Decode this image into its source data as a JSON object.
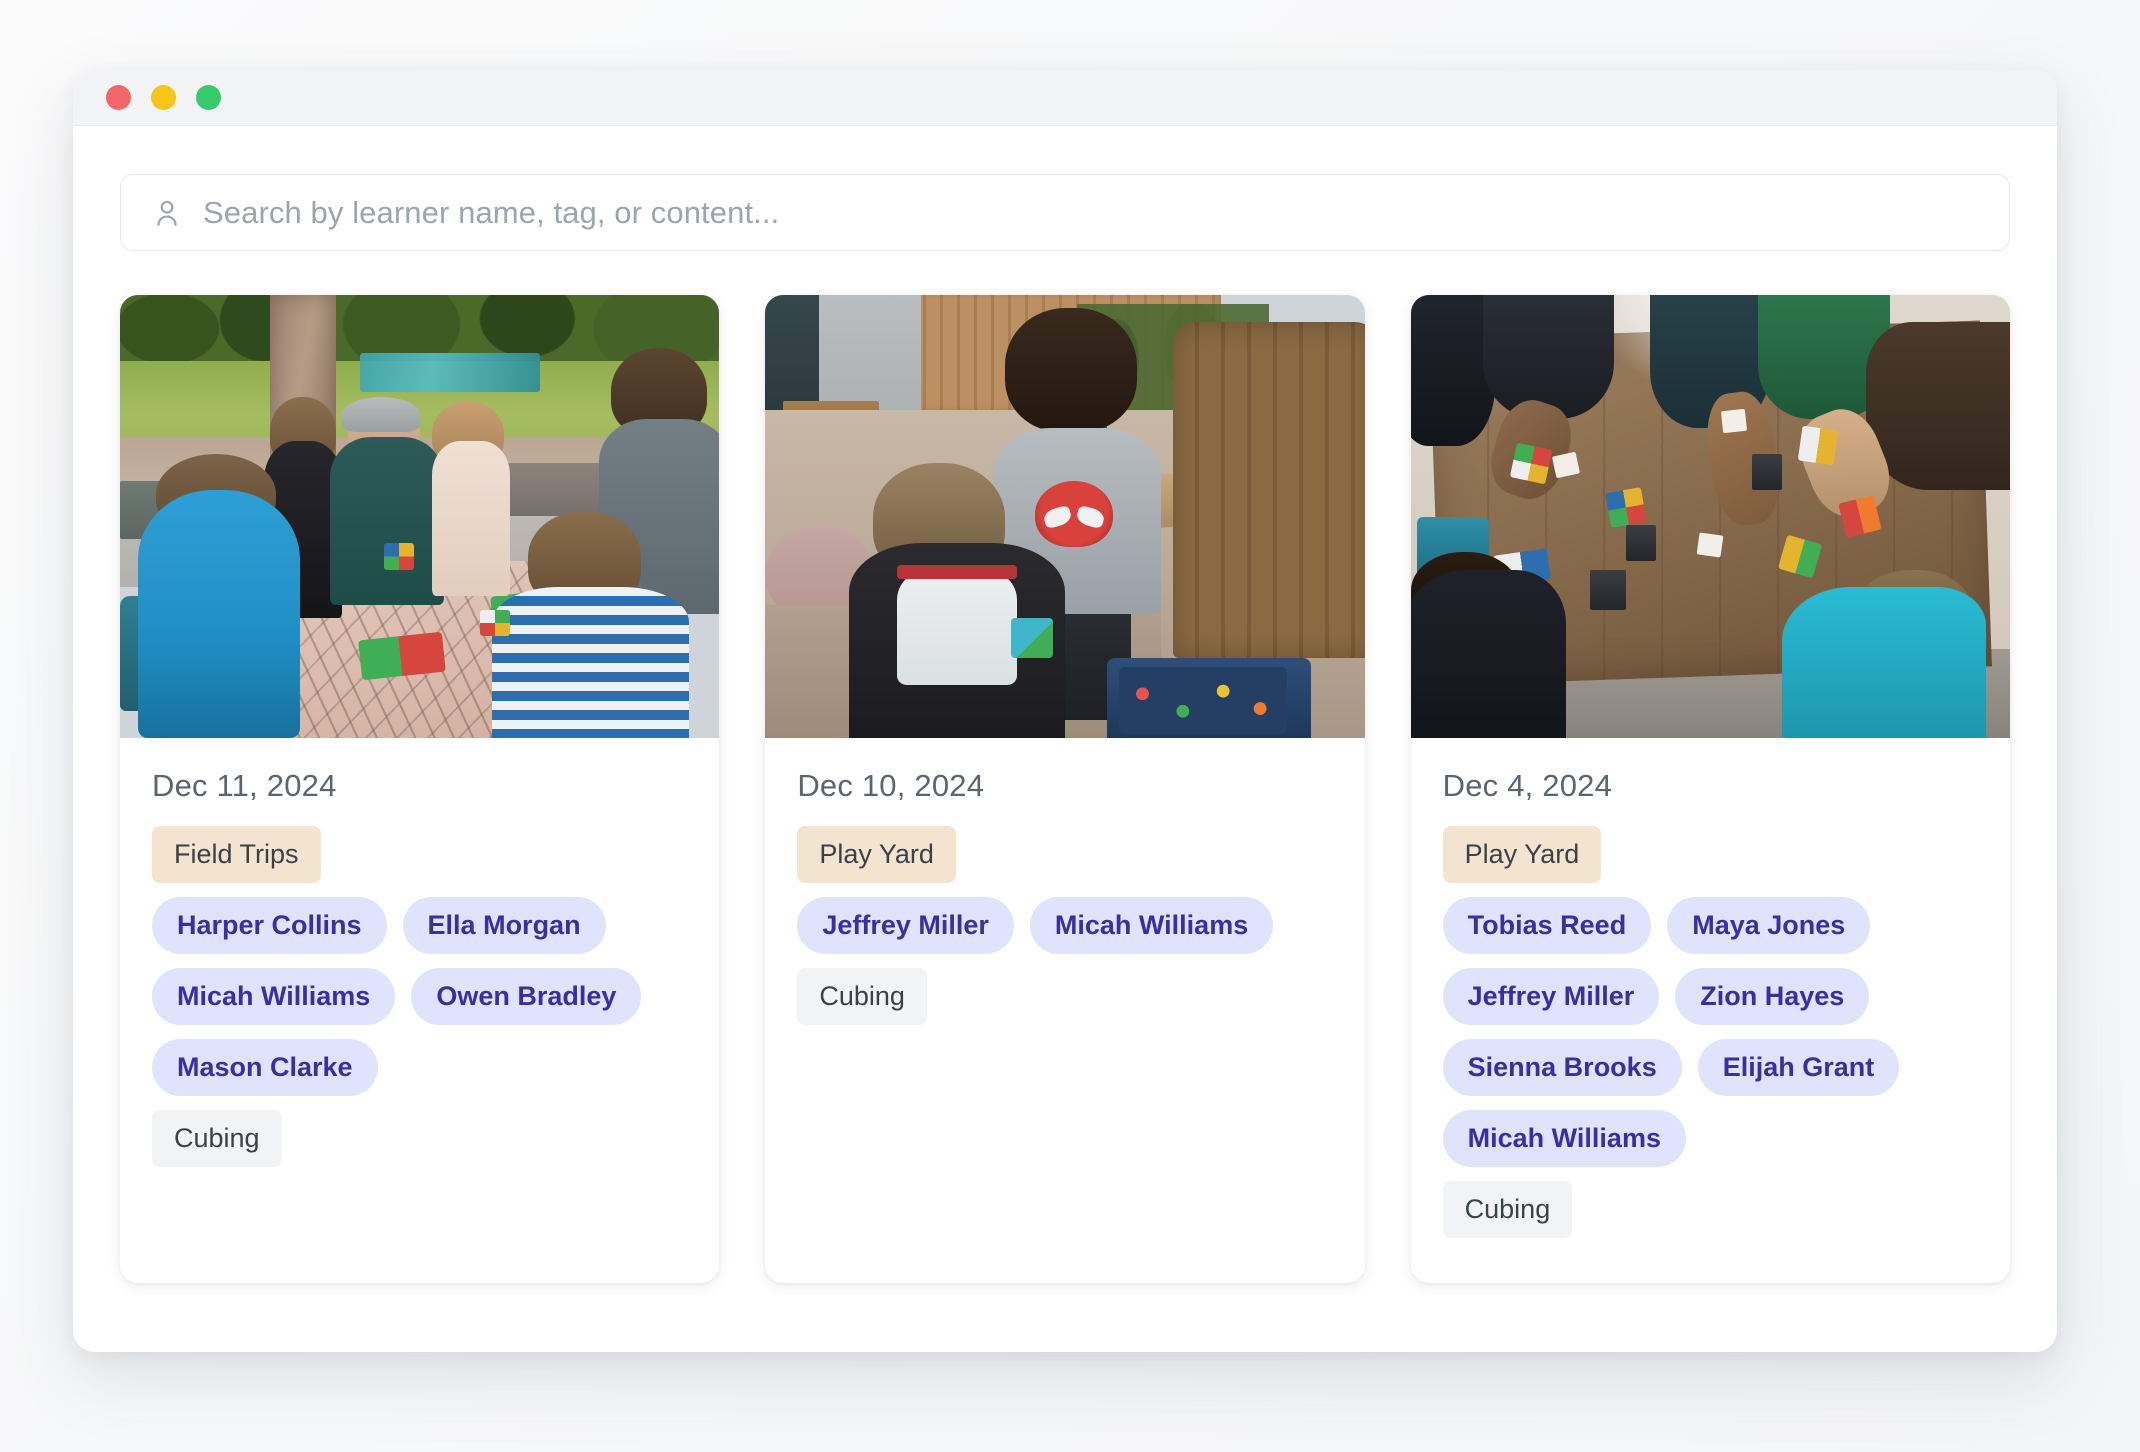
{
  "window": {
    "traffic_lights": [
      {
        "name": "close",
        "color": "#f2666b"
      },
      {
        "name": "minimize",
        "color": "#f5c518"
      },
      {
        "name": "maximize",
        "color": "#35cb6a"
      }
    ]
  },
  "search": {
    "icon": "person-icon",
    "placeholder": "Search by learner name, tag, or content...",
    "value": ""
  },
  "colors": {
    "location_tag_bg": "#f3e4d0",
    "location_tag_text": "#3b4149",
    "learner_tag_bg": "#dfe3fb",
    "learner_tag_text": "#3730a3",
    "topic_tag_bg": "#f1f3f5",
    "topic_tag_text": "#3b4149",
    "date_text": "#5b6570",
    "placeholder_text": "#9ea4ad",
    "titlebar_bg": "#f2f3f5",
    "card_bg": "#ffffff"
  },
  "cards": [
    {
      "date": "Dec 11, 2024",
      "photo_alt": "Children and an adult solving Rubik's cubes at a park pavilion picnic table",
      "location_tag": "Field Trips",
      "learners": [
        "Harper Collins",
        "Ella Morgan",
        "Micah Williams",
        "Owen Bradley",
        "Mason Clarke"
      ],
      "topic_tag": "Cubing"
    },
    {
      "date": "Dec 10, 2024",
      "photo_alt": "Two boys on a wooden deck working on a speed cube beside an open cube bag",
      "location_tag": "Play Yard",
      "learners": [
        "Jeffrey Miller",
        "Micah Williams"
      ],
      "topic_tag": "Cubing"
    },
    {
      "date": "Dec 4, 2024",
      "photo_alt": "Overhead view of many children around a wooden table solving cubes with timers",
      "location_tag": "Play Yard",
      "learners": [
        "Tobias Reed",
        "Maya Jones",
        "Jeffrey Miller",
        "Zion Hayes",
        "Sienna Brooks",
        "Elijah Grant",
        "Micah Williams"
      ],
      "topic_tag": "Cubing"
    }
  ]
}
